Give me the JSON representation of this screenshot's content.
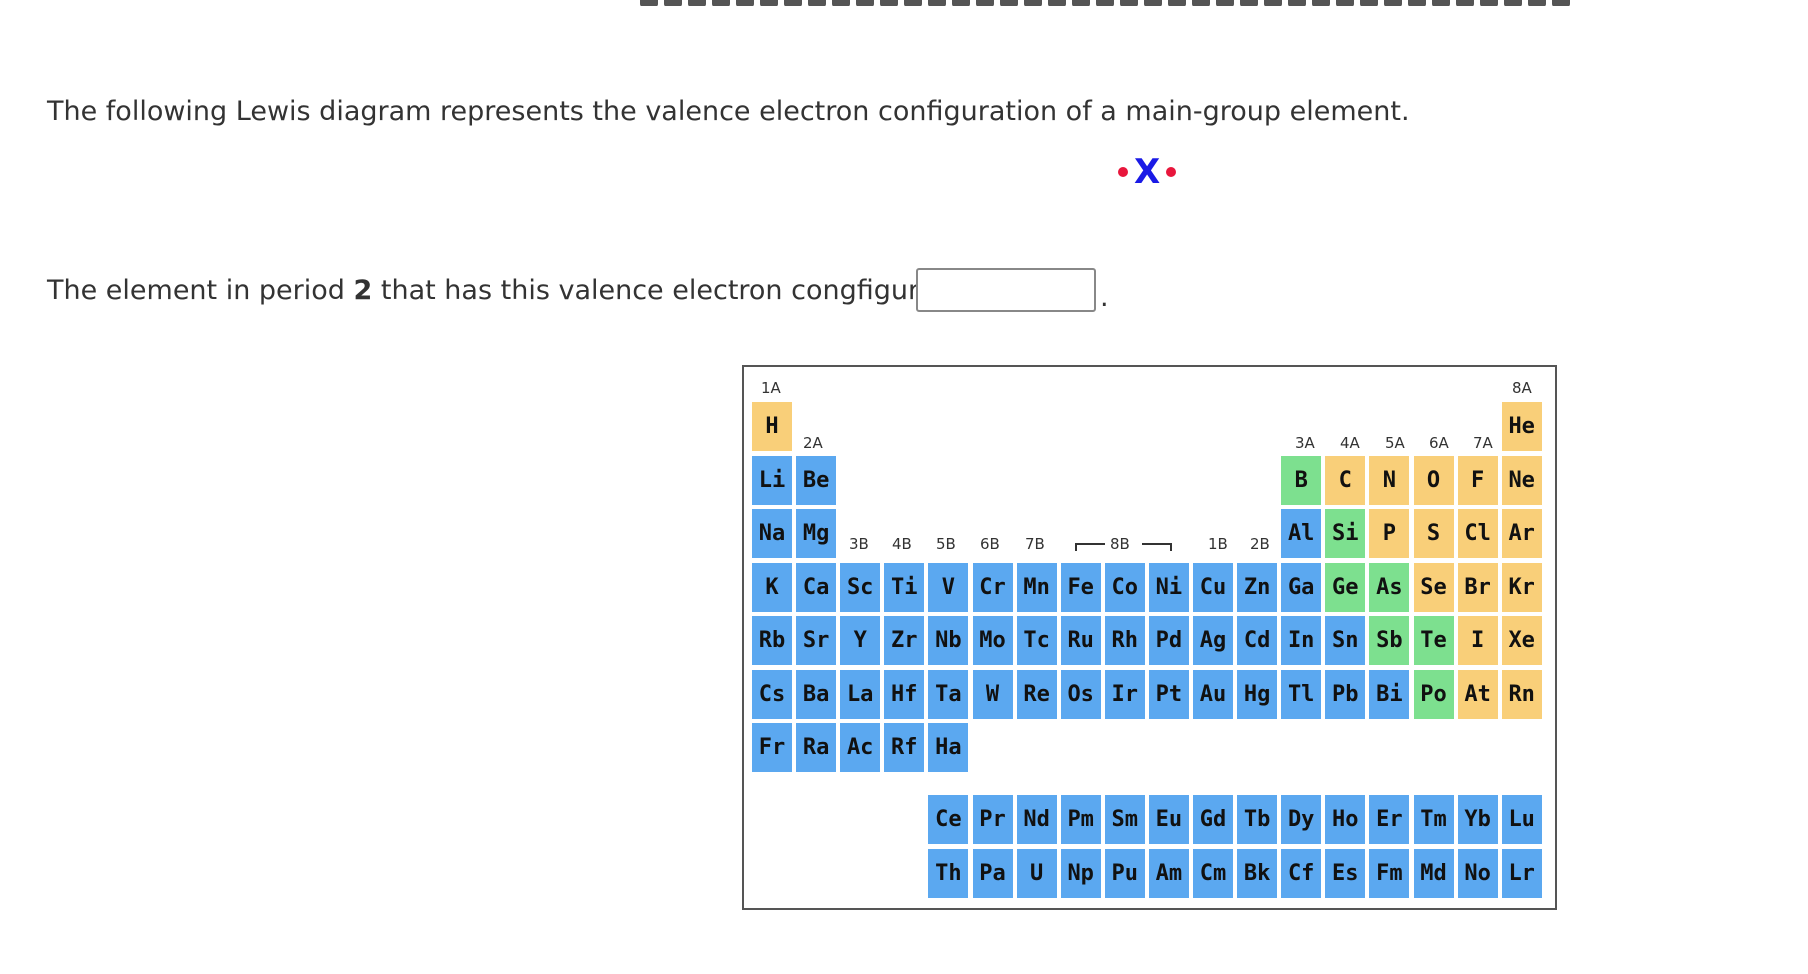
{
  "question": {
    "intro": "The following Lewis diagram represents the valence electron configuration of a main-group element.",
    "symbol": "X",
    "prompt_before": "The element in period ",
    "period_number": "2",
    "prompt_after": " that has this valence electron congfiguration is",
    "answer_value": "",
    "trailing": "."
  },
  "periodic_table": {
    "group_labels": {
      "g1": "1A",
      "g2": "2A",
      "g3": "3A",
      "g4": "4A",
      "g5": "5A",
      "g6": "6A",
      "g7": "7A",
      "g8": "8A",
      "t3": "3B",
      "t4": "4B",
      "t5": "5B",
      "t6": "6B",
      "t7": "7B",
      "t8": "8B",
      "t11": "1B",
      "t12": "2B"
    },
    "lanthanide_marker": "*",
    "actinide_marker": "**",
    "colors": {
      "metal": "#5ba8f0",
      "metalloid": "#7de08f",
      "nonmetal": "#f9cf79"
    },
    "elements": [
      {
        "s": "H",
        "t": "n"
      },
      {
        "s": "He",
        "t": "n"
      },
      {
        "s": "Li",
        "t": "m"
      },
      {
        "s": "Be",
        "t": "m"
      },
      {
        "s": "B",
        "t": "d"
      },
      {
        "s": "C",
        "t": "n"
      },
      {
        "s": "N",
        "t": "n"
      },
      {
        "s": "O",
        "t": "n"
      },
      {
        "s": "F",
        "t": "n"
      },
      {
        "s": "Ne",
        "t": "n"
      },
      {
        "s": "Na",
        "t": "m"
      },
      {
        "s": "Mg",
        "t": "m"
      },
      {
        "s": "Al",
        "t": "m"
      },
      {
        "s": "Si",
        "t": "d"
      },
      {
        "s": "P",
        "t": "n"
      },
      {
        "s": "S",
        "t": "n"
      },
      {
        "s": "Cl",
        "t": "n"
      },
      {
        "s": "Ar",
        "t": "n"
      },
      {
        "s": "K",
        "t": "m"
      },
      {
        "s": "Ca",
        "t": "m"
      },
      {
        "s": "Sc",
        "t": "m"
      },
      {
        "s": "Ti",
        "t": "m"
      },
      {
        "s": "V",
        "t": "m"
      },
      {
        "s": "Cr",
        "t": "m"
      },
      {
        "s": "Mn",
        "t": "m"
      },
      {
        "s": "Fe",
        "t": "m"
      },
      {
        "s": "Co",
        "t": "m"
      },
      {
        "s": "Ni",
        "t": "m"
      },
      {
        "s": "Cu",
        "t": "m"
      },
      {
        "s": "Zn",
        "t": "m"
      },
      {
        "s": "Ga",
        "t": "m"
      },
      {
        "s": "Ge",
        "t": "d"
      },
      {
        "s": "As",
        "t": "d"
      },
      {
        "s": "Se",
        "t": "n"
      },
      {
        "s": "Br",
        "t": "n"
      },
      {
        "s": "Kr",
        "t": "n"
      },
      {
        "s": "Rb",
        "t": "m"
      },
      {
        "s": "Sr",
        "t": "m"
      },
      {
        "s": "Y",
        "t": "m"
      },
      {
        "s": "Zr",
        "t": "m"
      },
      {
        "s": "Nb",
        "t": "m"
      },
      {
        "s": "Mo",
        "t": "m"
      },
      {
        "s": "Tc",
        "t": "m"
      },
      {
        "s": "Ru",
        "t": "m"
      },
      {
        "s": "Rh",
        "t": "m"
      },
      {
        "s": "Pd",
        "t": "m"
      },
      {
        "s": "Ag",
        "t": "m"
      },
      {
        "s": "Cd",
        "t": "m"
      },
      {
        "s": "In",
        "t": "m"
      },
      {
        "s": "Sn",
        "t": "m"
      },
      {
        "s": "Sb",
        "t": "d"
      },
      {
        "s": "Te",
        "t": "d"
      },
      {
        "s": "I",
        "t": "n"
      },
      {
        "s": "Xe",
        "t": "n"
      },
      {
        "s": "Cs",
        "t": "m"
      },
      {
        "s": "Ba",
        "t": "m"
      },
      {
        "s": "La",
        "t": "m"
      },
      {
        "s": "Hf",
        "t": "m"
      },
      {
        "s": "Ta",
        "t": "m"
      },
      {
        "s": "W",
        "t": "m"
      },
      {
        "s": "Re",
        "t": "m"
      },
      {
        "s": "Os",
        "t": "m"
      },
      {
        "s": "Ir",
        "t": "m"
      },
      {
        "s": "Pt",
        "t": "m"
      },
      {
        "s": "Au",
        "t": "m"
      },
      {
        "s": "Hg",
        "t": "m"
      },
      {
        "s": "Tl",
        "t": "m"
      },
      {
        "s": "Pb",
        "t": "m"
      },
      {
        "s": "Bi",
        "t": "m"
      },
      {
        "s": "Po",
        "t": "d"
      },
      {
        "s": "At",
        "t": "n"
      },
      {
        "s": "Rn",
        "t": "n"
      },
      {
        "s": "Fr",
        "t": "m"
      },
      {
        "s": "Ra",
        "t": "m"
      },
      {
        "s": "Ac",
        "t": "m"
      },
      {
        "s": "Rf",
        "t": "m"
      },
      {
        "s": "Ha",
        "t": "m"
      },
      {
        "s": "Ce",
        "t": "m"
      },
      {
        "s": "Pr",
        "t": "m"
      },
      {
        "s": "Nd",
        "t": "m"
      },
      {
        "s": "Pm",
        "t": "m"
      },
      {
        "s": "Sm",
        "t": "m"
      },
      {
        "s": "Eu",
        "t": "m"
      },
      {
        "s": "Gd",
        "t": "m"
      },
      {
        "s": "Tb",
        "t": "m"
      },
      {
        "s": "Dy",
        "t": "m"
      },
      {
        "s": "Ho",
        "t": "m"
      },
      {
        "s": "Er",
        "t": "m"
      },
      {
        "s": "Tm",
        "t": "m"
      },
      {
        "s": "Yb",
        "t": "m"
      },
      {
        "s": "Lu",
        "t": "m"
      },
      {
        "s": "Th",
        "t": "m"
      },
      {
        "s": "Pa",
        "t": "m"
      },
      {
        "s": "U",
        "t": "m"
      },
      {
        "s": "Np",
        "t": "m"
      },
      {
        "s": "Pu",
        "t": "m"
      },
      {
        "s": "Am",
        "t": "m"
      },
      {
        "s": "Cm",
        "t": "m"
      },
      {
        "s": "Bk",
        "t": "m"
      },
      {
        "s": "Cf",
        "t": "m"
      },
      {
        "s": "Es",
        "t": "m"
      },
      {
        "s": "Fm",
        "t": "m"
      },
      {
        "s": "Md",
        "t": "m"
      },
      {
        "s": "No",
        "t": "m"
      },
      {
        "s": "Lr",
        "t": "m"
      }
    ]
  }
}
